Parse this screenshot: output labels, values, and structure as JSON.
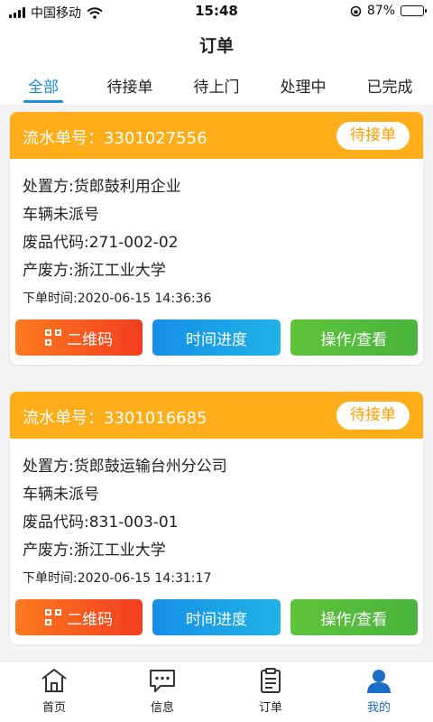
{
  "statusbar": {
    "carrier": "中国移动",
    "time": "15:48",
    "battery_text": "87%",
    "battery_level": 0.87
  },
  "header": {
    "title": "订单"
  },
  "tabs": [
    {
      "label": "全部",
      "active": true
    },
    {
      "label": "待接单",
      "active": false
    },
    {
      "label": "待上门",
      "active": false
    },
    {
      "label": "处理中",
      "active": false
    },
    {
      "label": "已完成",
      "active": false
    }
  ],
  "orders": [
    {
      "serial": "流水单号：3301027556",
      "status": "待接单",
      "handler": "处置方:货郎鼓利用企业",
      "vehicle": "车辆未派号",
      "waste_code": "废品代码:271-002-02",
      "producer": "产废方:浙江工业大学",
      "order_time": "下单时间:2020-06-15 14:36:36"
    },
    {
      "serial": "流水单号：3301016685",
      "status": "待接单",
      "handler": "处置方:货郎鼓运输台州分公司",
      "vehicle": "车辆未派号",
      "waste_code": "废品代码:831-003-01",
      "producer": "产废方:浙江工业大学",
      "order_time": "下单时间:2020-06-15 14:31:17"
    }
  ],
  "actions": {
    "qr_label": "二维码",
    "progress_label": "时间进度",
    "operate_label": "操作/查看"
  },
  "bottom_nav": [
    {
      "label": "首页",
      "icon": "home-icon",
      "active": false
    },
    {
      "label": "信息",
      "icon": "message-icon",
      "active": false
    },
    {
      "label": "订单",
      "icon": "clipboard-icon",
      "active": false
    },
    {
      "label": "我的",
      "icon": "user-icon",
      "active": true
    }
  ],
  "colors": {
    "accent": "#1a8fd8",
    "card_header": "#ffae1a",
    "status_text": "#ff9a00"
  }
}
